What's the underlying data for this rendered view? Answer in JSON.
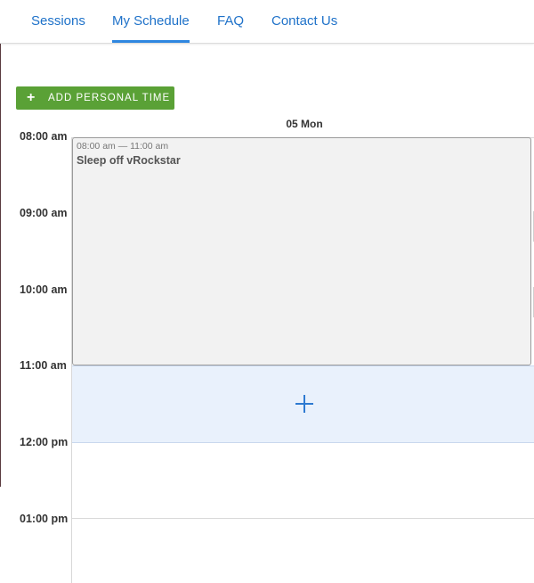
{
  "nav": {
    "tabs": [
      {
        "label": "Sessions"
      },
      {
        "label": "My Schedule"
      },
      {
        "label": "FAQ"
      },
      {
        "label": "Contact Us"
      }
    ],
    "active_tab": "My Schedule"
  },
  "toolbar": {
    "add_icon": "+",
    "add_label": "ADD PERSONAL TIME"
  },
  "calendar": {
    "day_header": "05 Mon",
    "hours": [
      "08:00 am",
      "09:00 am",
      "10:00 am",
      "11:00 am",
      "12:00 pm",
      "01:00 pm"
    ],
    "event": {
      "time": "08:00 am — 11:00 am",
      "title": "Sleep off vRockstar"
    },
    "new_slot_icon": "plus-icon"
  },
  "colors": {
    "accent": "#1f72c9",
    "button": "#5aa136",
    "event_bg": "#f2f2f2",
    "slot_bg": "#e9f1fc"
  }
}
